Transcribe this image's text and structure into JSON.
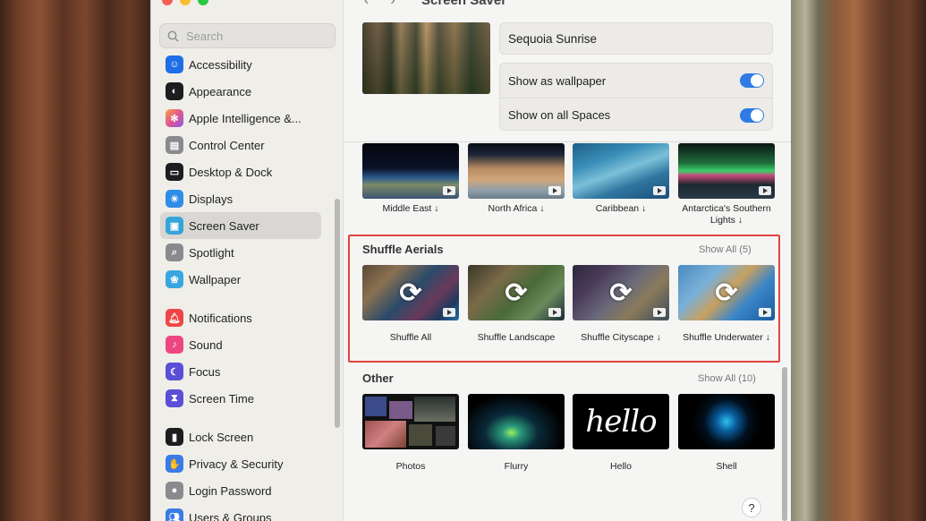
{
  "window": {
    "title": "Screen Saver"
  },
  "search": {
    "placeholder": "Search"
  },
  "sidebar": {
    "items": [
      {
        "label": "Accessibility",
        "icon": "accessibility-icon",
        "color": "#1e6ee8"
      },
      {
        "label": "Appearance",
        "icon": "appearance-icon",
        "color": "#1d1d1f"
      },
      {
        "label": "Apple Intelligence &...",
        "icon": "apple-intelligence-icon",
        "color": "#e0568f"
      },
      {
        "label": "Control Center",
        "icon": "control-center-icon",
        "color": "#8a8a8e"
      },
      {
        "label": "Desktop & Dock",
        "icon": "desktop-dock-icon",
        "color": "#1d1d1f"
      },
      {
        "label": "Displays",
        "icon": "displays-icon",
        "color": "#2f8de8"
      },
      {
        "label": "Screen Saver",
        "icon": "screen-saver-icon",
        "color": "#35a4d8"
      },
      {
        "label": "Spotlight",
        "icon": "spotlight-icon",
        "color": "#8a8a8e"
      },
      {
        "label": "Wallpaper",
        "icon": "wallpaper-icon",
        "color": "#3aa6e0"
      },
      {
        "label": "Notifications",
        "icon": "notifications-icon",
        "color": "#ee4646"
      },
      {
        "label": "Sound",
        "icon": "sound-icon",
        "color": "#ee4680"
      },
      {
        "label": "Focus",
        "icon": "focus-icon",
        "color": "#5a4fd6"
      },
      {
        "label": "Screen Time",
        "icon": "screen-time-icon",
        "color": "#5a4fd6"
      },
      {
        "label": "Lock Screen",
        "icon": "lock-screen-icon",
        "color": "#1d1d1f"
      },
      {
        "label": "Privacy & Security",
        "icon": "privacy-icon",
        "color": "#3a7be6"
      },
      {
        "label": "Login Password",
        "icon": "login-password-icon",
        "color": "#8a8a8e"
      },
      {
        "label": "Users & Groups",
        "icon": "users-groups-icon",
        "color": "#3a7be6"
      }
    ],
    "selected": "Screen Saver"
  },
  "current": {
    "name": "Sequoia Sunrise",
    "toggles": [
      {
        "label": "Show as wallpaper",
        "on": true
      },
      {
        "label": "Show on all Spaces",
        "on": true
      }
    ]
  },
  "earth_row": [
    {
      "label": "Middle East ↓"
    },
    {
      "label": "North Africa ↓"
    },
    {
      "label": "Caribbean ↓"
    },
    {
      "label": "Antarctica's Southern Lights ↓"
    }
  ],
  "shuffle_section": {
    "title": "Shuffle Aerials",
    "show_all": "Show All (5)",
    "items": [
      {
        "label": "Shuffle All"
      },
      {
        "label": "Shuffle Landscape"
      },
      {
        "label": "Shuffle Cityscape ↓"
      },
      {
        "label": "Shuffle Underwater ↓"
      }
    ]
  },
  "other_section": {
    "title": "Other",
    "show_all": "Show All (10)",
    "items": [
      {
        "label": "Photos"
      },
      {
        "label": "Flurry"
      },
      {
        "label": "Hello",
        "art_text": "hello"
      },
      {
        "label": "Shell"
      }
    ]
  },
  "help": {
    "label": "?"
  }
}
